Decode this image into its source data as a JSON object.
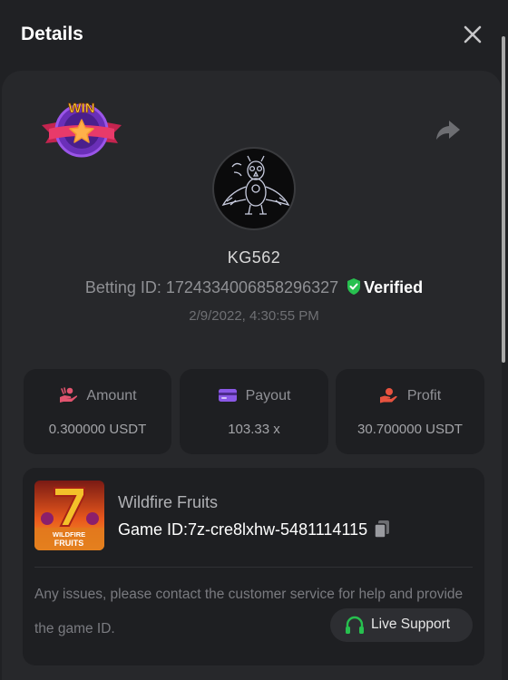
{
  "header": {
    "title": "Details",
    "close_icon": "close-icon"
  },
  "bet": {
    "badge_text": "WIN",
    "username": "KG562",
    "betting_id_label": "Betting ID: 1724334006858296327",
    "verified_label": "Verified",
    "timestamp": "2/9/2022, 4:30:55 PM"
  },
  "stats": [
    {
      "label": "Amount",
      "value": "0.300000 USDT",
      "icon": "money-hand-icon",
      "icon_color": "#e2546f"
    },
    {
      "label": "Payout",
      "value": "103.33 x",
      "icon": "card-icon",
      "icon_color": "#8a58e6"
    },
    {
      "label": "Profit",
      "value": "30.700000 USDT",
      "icon": "profit-hand-icon",
      "icon_color": "#e8533f"
    }
  ],
  "game": {
    "name": "Wildfire Fruits",
    "game_id_label": "Game ID:7z-cre8lxhw-5481114115",
    "thumb_text": "WILDFIRE FRUITS"
  },
  "support": {
    "notice": "Any issues, please contact the customer service for help and provide the game ID.",
    "button_label": "Live Support"
  },
  "colors": {
    "background": "#202124",
    "panel": "#27282b",
    "card": "#1e1f22",
    "verified": "#27c04f",
    "support_icon": "#27c04f"
  }
}
